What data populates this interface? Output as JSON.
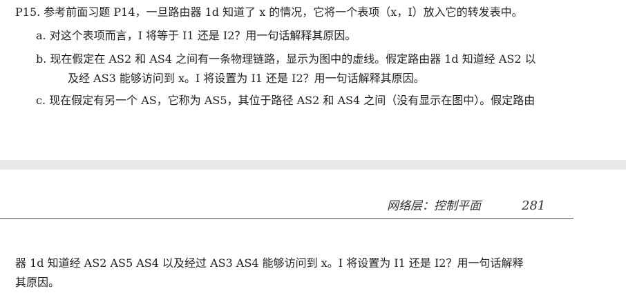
{
  "page_top": {
    "problem": "P15. 参考前面习题 P14，一旦路由器 1d 知道了 x 的情况，它将一个表项（x，I）放入它的转发表中。",
    "item_a": "a. 对这个表项而言，I 将等于 I1 还是 I2？用一句话解释其原因。",
    "item_b_line1": "b. 现在假定在 AS2 和 AS4 之间有一条物理链路，显示为图中的虚线。假定路由器 1d 知道经 AS2 以",
    "item_b_line2": "及经 AS3 能够访问到 x。I 将设置为 I1 还是 I2？用一句话解释其原因。",
    "item_c": "c. 现在假定有另一个 AS，它称为 AS5，其位于路径 AS2 和 AS4 之间（没有显示在图中）。假定路由"
  },
  "running_header": {
    "title": "网络层：控制平面",
    "page_number": "281"
  },
  "page_bottom": {
    "continuation_line1": "器 1d 知道经 AS2 AS5 AS4 以及经过 AS3 AS4 能够访问到 x。I 将设置为 I1 还是 I2？用一句话解释",
    "continuation_line2": "其原因。"
  }
}
